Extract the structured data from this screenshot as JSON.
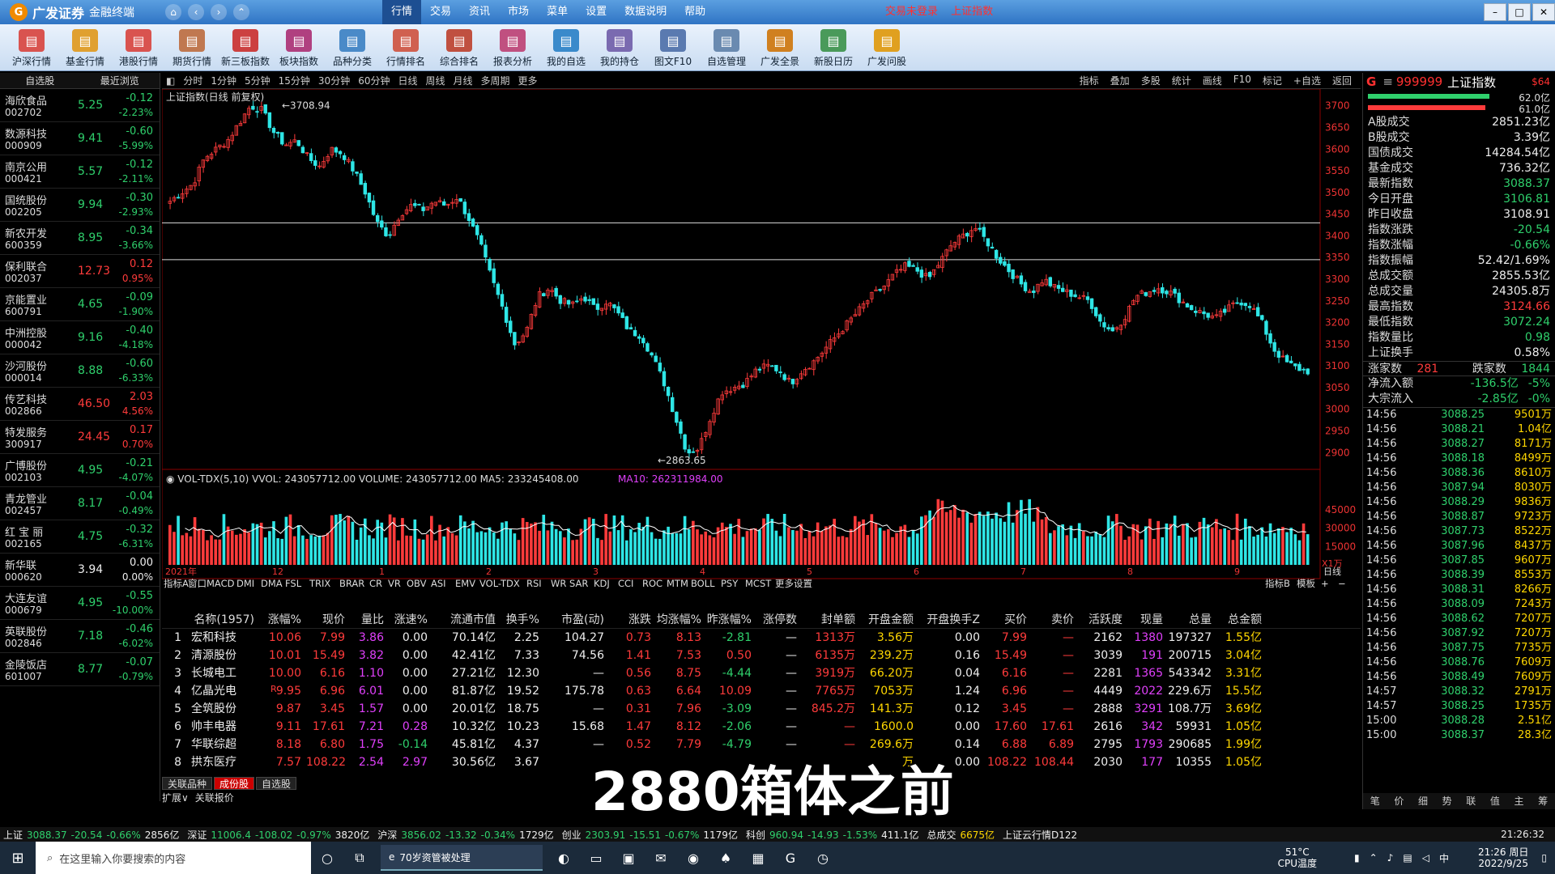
{
  "app": {
    "name": "广发证券",
    "subtitle": "金融终端",
    "login_status": "交易未登录",
    "index_link": "上证指数"
  },
  "top_menu": [
    "行情",
    "交易",
    "资讯",
    "市场",
    "菜单",
    "设置",
    "数据说明",
    "帮助"
  ],
  "toolbar": [
    {
      "label": "沪深行情",
      "icon": "market-icon",
      "color": "#d9534f"
    },
    {
      "label": "基金行情",
      "icon": "fund-icon",
      "color": "#e0a030"
    },
    {
      "label": "港股行情",
      "icon": "hk-icon",
      "color": "#d9534f"
    },
    {
      "label": "期货行情",
      "icon": "futures-icon",
      "color": "#c07850"
    },
    {
      "label": "新三板指数",
      "icon": "neeq-icon",
      "color": "#cc4040"
    },
    {
      "label": "板块指数",
      "icon": "sector-icon",
      "color": "#b04080"
    },
    {
      "label": "品种分类",
      "icon": "category-icon",
      "color": "#4a8ac8"
    },
    {
      "label": "行情排名",
      "icon": "rank-icon",
      "color": "#d06050"
    },
    {
      "label": "综合排名",
      "icon": "composite-icon",
      "color": "#c05040"
    },
    {
      "label": "报表分析",
      "icon": "report-icon",
      "color": "#c05080"
    },
    {
      "label": "我的自选",
      "icon": "favorite-icon",
      "color": "#3a8acb"
    },
    {
      "label": "我的持仓",
      "icon": "holding-icon",
      "color": "#7a6ab0"
    },
    {
      "label": "图文F10",
      "icon": "f10-icon",
      "color": "#5a7ab0"
    },
    {
      "label": "自选管理",
      "icon": "manage-icon",
      "color": "#6a8ab0"
    },
    {
      "label": "广发全景",
      "icon": "panorama-icon",
      "color": "#d08020"
    },
    {
      "label": "新股日历",
      "icon": "calendar-icon",
      "color": "#4a9a5a"
    },
    {
      "label": "广发问股",
      "icon": "ask-icon",
      "color": "#e0a020"
    }
  ],
  "watchlist": {
    "tabs": [
      "自选股",
      "最近浏览"
    ],
    "items": [
      {
        "name": "海欣食品",
        "code": "002702",
        "price": "5.25",
        "change": "-0.12",
        "pct": "-2.23%",
        "dir": "down"
      },
      {
        "name": "数源科技",
        "code": "000909",
        "price": "9.41",
        "change": "-0.60",
        "pct": "-5.99%",
        "dir": "down"
      },
      {
        "name": "南京公用",
        "code": "000421",
        "price": "5.57",
        "change": "-0.12",
        "pct": "-2.11%",
        "dir": "down"
      },
      {
        "name": "国统股份",
        "code": "002205",
        "price": "9.94",
        "change": "-0.30",
        "pct": "-2.93%",
        "dir": "down"
      },
      {
        "name": "新农开发",
        "code": "600359",
        "price": "8.95",
        "change": "-0.34",
        "pct": "-3.66%",
        "dir": "down"
      },
      {
        "name": "保利联合",
        "code": "002037",
        "price": "12.73",
        "change": "0.12",
        "pct": "0.95%",
        "dir": "up"
      },
      {
        "name": "京能置业",
        "code": "600791",
        "price": "4.65",
        "change": "-0.09",
        "pct": "-1.90%",
        "dir": "down"
      },
      {
        "name": "中洲控股",
        "code": "000042",
        "price": "9.16",
        "change": "-0.40",
        "pct": "-4.18%",
        "dir": "down"
      },
      {
        "name": "沙河股份",
        "code": "000014",
        "price": "8.88",
        "change": "-0.60",
        "pct": "-6.33%",
        "dir": "down"
      },
      {
        "name": "传艺科技",
        "code": "002866",
        "price": "46.50",
        "change": "2.03",
        "pct": "4.56%",
        "dir": "up"
      },
      {
        "name": "特发服务",
        "code": "300917",
        "price": "24.45",
        "change": "0.17",
        "pct": "0.70%",
        "dir": "up"
      },
      {
        "name": "广博股份",
        "code": "002103",
        "price": "4.95",
        "change": "-0.21",
        "pct": "-4.07%",
        "dir": "down"
      },
      {
        "name": "青龙管业",
        "code": "002457",
        "price": "8.17",
        "change": "-0.04",
        "pct": "-0.49%",
        "dir": "down"
      },
      {
        "name": "红 宝 丽",
        "code": "002165",
        "price": "4.75",
        "change": "-0.32",
        "pct": "-6.31%",
        "dir": "down"
      },
      {
        "name": "新华联",
        "code": "000620",
        "price": "3.94",
        "change": "0.00",
        "pct": "0.00%",
        "dir": "flat"
      },
      {
        "name": "大连友谊",
        "code": "000679",
        "price": "4.95",
        "change": "-0.55",
        "pct": "-10.00%",
        "dir": "down"
      },
      {
        "name": "英联股份",
        "code": "002846",
        "price": "7.18",
        "change": "-0.46",
        "pct": "-6.02%",
        "dir": "down"
      },
      {
        "name": "金陵饭店",
        "code": "601007",
        "price": "8.77",
        "change": "-0.07",
        "pct": "-0.79%",
        "dir": "down"
      }
    ]
  },
  "period_bar": {
    "items": [
      "分时",
      "1分钟",
      "5分钟",
      "15分钟",
      "30分钟",
      "60分钟",
      "日线",
      "周线",
      "月线",
      "多周期",
      "更多"
    ],
    "right": [
      "指标",
      "叠加",
      "多股",
      "统计",
      "画线",
      "F10",
      "标记",
      "+自选",
      "返回"
    ]
  },
  "chart_title": "上证指数(日线 前复权)",
  "chart_data": {
    "type": "candlestick",
    "title": "上证指数(日线 前复权)",
    "ylim": [
      2880,
      3720
    ],
    "y_ticks": [
      "3700",
      "3650",
      "3600",
      "3550",
      "3500",
      "3450",
      "3400",
      "3350",
      "3300",
      "3250",
      "3200",
      "3150",
      "3100",
      "3050",
      "3000",
      "2950",
      "2900"
    ],
    "x_labels": [
      "2021年",
      "12",
      "1",
      "2",
      "3",
      "4",
      "5",
      "6",
      "7",
      "8",
      "9"
    ],
    "annotations": {
      "high": "3708.94",
      "low": "2863.65"
    },
    "hlines": [
      3430,
      3345
    ],
    "close_path": [
      3480,
      3500,
      3520,
      3580,
      3600,
      3620,
      3660,
      3700,
      3690,
      3640,
      3610,
      3620,
      3580,
      3560,
      3600,
      3590,
      3550,
      3500,
      3430,
      3400,
      3450,
      3470,
      3460,
      3480,
      3470,
      3490,
      3440,
      3380,
      3300,
      3230,
      3150,
      3180,
      3260,
      3280,
      3250,
      3240,
      3260,
      3230,
      3250,
      3220,
      3180,
      3170,
      3120,
      3060,
      2980,
      2900,
      2910,
      2980,
      3040,
      3050,
      3060,
      3090,
      3100,
      3090,
      3060,
      3090,
      3110,
      3140,
      3170,
      3200,
      3230,
      3260,
      3280,
      3310,
      3330,
      3320,
      3300,
      3340,
      3380,
      3400,
      3420,
      3390,
      3350,
      3320,
      3290,
      3270,
      3300,
      3280,
      3270,
      3260,
      3250,
      3200,
      3180,
      3210,
      3260,
      3270,
      3280,
      3270,
      3250,
      3230,
      3220,
      3210,
      3230,
      3250,
      3240,
      3200,
      3140,
      3110,
      3095,
      3088
    ],
    "volume_indicator": {
      "name": "VOL-TDX(5,10)",
      "VVOL": "243057712.00",
      "VOLUME": "243057712.00",
      "MA5": "233245408.00",
      "MA10": "262311984.00",
      "y_ticks": [
        "45000",
        "30000",
        "15000"
      ],
      "unit": "X1万"
    },
    "period_label": "日线"
  },
  "indicator_tabs": [
    "指标A",
    "窗口",
    "MACD",
    "DMI",
    "DMA",
    "FSL",
    "TRIX",
    "BRAR",
    "CR",
    "VR",
    "OBV",
    "ASI",
    "EMV",
    "VOL-TDX",
    "RSI",
    "WR",
    "SAR",
    "KDJ",
    "CCI",
    "ROC",
    "MTM",
    "BOLL",
    "PSY",
    "MCST",
    "更多",
    "设置"
  ],
  "indicator_tabs_right": [
    "指标B",
    "模板",
    "+",
    "−"
  ],
  "table": {
    "headers": [
      "",
      "名称(1957)",
      "涨幅%",
      "现价",
      "量比",
      "涨速%",
      "流通市值",
      "换手%",
      "市盈(动)",
      "涨跌",
      "均涨幅%",
      "昨涨幅%",
      "涨停数",
      "封单额",
      "开盘金额",
      "开盘换手Z",
      "买价",
      "卖价",
      "活跃度",
      "现量",
      "总量",
      "总金额"
    ],
    "rows": [
      [
        "1",
        "宏和科技",
        "10.06",
        "7.99",
        "3.86",
        "0.00",
        "70.14亿",
        "2.25",
        "104.27",
        "0.73",
        "8.13",
        "-2.81",
        "—",
        "1313万",
        "3.56万",
        "0.00",
        "7.99",
        "—",
        "2162",
        "1380",
        "197327",
        "1.55亿"
      ],
      [
        "2",
        "清源股份",
        "10.01",
        "15.49",
        "3.82",
        "0.00",
        "42.41亿",
        "7.33",
        "74.56",
        "1.41",
        "7.53",
        "0.50",
        "—",
        "6135万",
        "239.2万",
        "0.16",
        "15.49",
        "—",
        "3039",
        "191",
        "200715",
        "3.04亿"
      ],
      [
        "3",
        "长城电工",
        "10.00",
        "6.16",
        "1.10",
        "0.00",
        "27.21亿",
        "12.30",
        "—",
        "0.56",
        "8.75",
        "-4.44",
        "—",
        "3919万",
        "66.20万",
        "0.04",
        "6.16",
        "—",
        "2281",
        "1365",
        "543342",
        "3.31亿"
      ],
      [
        "4",
        "亿晶光电",
        "9.95",
        "6.96",
        "6.01",
        "0.00",
        "81.87亿",
        "19.52",
        "175.78",
        "0.63",
        "6.64",
        "10.09",
        "—",
        "7765万",
        "7053万",
        "1.24",
        "6.96",
        "—",
        "4449",
        "2022",
        "229.6万",
        "15.5亿"
      ],
      [
        "5",
        "全筑股份",
        "9.87",
        "3.45",
        "1.57",
        "0.00",
        "20.01亿",
        "18.75",
        "—",
        "0.31",
        "7.96",
        "-3.09",
        "—",
        "845.2万",
        "141.3万",
        "0.12",
        "3.45",
        "—",
        "2888",
        "3291",
        "108.7万",
        "3.69亿"
      ],
      [
        "6",
        "帅丰电器",
        "9.11",
        "17.61",
        "7.21",
        "0.28",
        "10.32亿",
        "10.23",
        "15.68",
        "1.47",
        "8.12",
        "-2.06",
        "—",
        "—",
        "1600.0",
        "0.00",
        "17.60",
        "17.61",
        "2616",
        "342",
        "59931",
        "1.05亿"
      ],
      [
        "7",
        "华联综超",
        "8.18",
        "6.80",
        "1.75",
        "-0.14",
        "45.81亿",
        "4.37",
        "—",
        "0.52",
        "7.79",
        "-4.79",
        "—",
        "—",
        "269.6万",
        "0.14",
        "6.88",
        "6.89",
        "2795",
        "1793",
        "290685",
        "1.99亿"
      ],
      [
        "8",
        "拱东医疗",
        "7.57",
        "108.22",
        "2.54",
        "2.97",
        "30.56亿",
        "3.67",
        "",
        "",
        "",
        "",
        "",
        "",
        "万",
        "0.00",
        "108.22",
        "108.44",
        "2030",
        "177",
        "10355",
        "1.05亿"
      ]
    ],
    "marker": "R"
  },
  "bottom_tabs": [
    "关联品种",
    "成份股",
    "自选股"
  ],
  "bottom_tabs2": [
    "扩展∨",
    "关联报价"
  ],
  "right_panel": {
    "code": "999999",
    "name": "上证指数",
    "tag": "G",
    "num": "$64",
    "bar1": "62.0亿",
    "bar2": "61.0亿",
    "stats": [
      {
        "k": "A股成交",
        "v": "2851.23亿",
        "c": "white"
      },
      {
        "k": "B股成交",
        "v": "3.39亿",
        "c": "white"
      },
      {
        "k": "国债成交",
        "v": "14284.54亿",
        "c": "white"
      },
      {
        "k": "基金成交",
        "v": "736.32亿",
        "c": "white"
      },
      {
        "k": "最新指数",
        "v": "3088.37",
        "c": "green"
      },
      {
        "k": "今日开盘",
        "v": "3106.81",
        "c": "green"
      },
      {
        "k": "昨日收盘",
        "v": "3108.91",
        "c": "white"
      },
      {
        "k": "指数涨跌",
        "v": "-20.54",
        "c": "green"
      },
      {
        "k": "指数涨幅",
        "v": "-0.66%",
        "c": "green"
      },
      {
        "k": "指数振幅",
        "v": "52.42/1.69%",
        "c": "white"
      },
      {
        "k": "总成交额",
        "v": "2855.53亿",
        "c": "white"
      },
      {
        "k": "总成交量",
        "v": "24305.8万",
        "c": "white"
      },
      {
        "k": "最高指数",
        "v": "3124.66",
        "c": "red"
      },
      {
        "k": "最低指数",
        "v": "3072.24",
        "c": "green"
      },
      {
        "k": "指数量比",
        "v": "0.98",
        "c": "green"
      },
      {
        "k": "上证换手",
        "v": "0.58%",
        "c": "white"
      }
    ],
    "updown": {
      "up_label": "涨家数",
      "up": "281",
      "down_label": "跌家数",
      "down": "1844"
    },
    "flows": [
      {
        "k": "净流入额",
        "v": "-136.5亿",
        "p": "-5%"
      },
      {
        "k": "大宗流入",
        "v": "-2.85亿",
        "p": "-0%"
      }
    ],
    "ticks": [
      {
        "t": "14:56",
        "p": "3088.25",
        "v": "9501万"
      },
      {
        "t": "14:56",
        "p": "3088.21",
        "v": "1.04亿"
      },
      {
        "t": "14:56",
        "p": "3088.27",
        "v": "8171万"
      },
      {
        "t": "14:56",
        "p": "3088.18",
        "v": "8499万"
      },
      {
        "t": "14:56",
        "p": "3088.36",
        "v": "8610万"
      },
      {
        "t": "14:56",
        "p": "3087.94",
        "v": "8030万"
      },
      {
        "t": "14:56",
        "p": "3088.29",
        "v": "9836万"
      },
      {
        "t": "14:56",
        "p": "3088.87",
        "v": "9723万"
      },
      {
        "t": "14:56",
        "p": "3087.73",
        "v": "8522万"
      },
      {
        "t": "14:56",
        "p": "3087.96",
        "v": "8437万"
      },
      {
        "t": "14:56",
        "p": "3087.85",
        "v": "9607万"
      },
      {
        "t": "14:56",
        "p": "3088.39",
        "v": "8553万"
      },
      {
        "t": "14:56",
        "p": "3088.31",
        "v": "8266万"
      },
      {
        "t": "14:56",
        "p": "3088.09",
        "v": "7243万"
      },
      {
        "t": "14:56",
        "p": "3088.62",
        "v": "7207万"
      },
      {
        "t": "14:56",
        "p": "3087.92",
        "v": "7207万"
      },
      {
        "t": "14:56",
        "p": "3087.75",
        "v": "7735万"
      },
      {
        "t": "14:56",
        "p": "3088.76",
        "v": "7609万"
      },
      {
        "t": "14:56",
        "p": "3088.49",
        "v": "7609万"
      },
      {
        "t": "14:57",
        "p": "3088.32",
        "v": "2791万"
      },
      {
        "t": "14:57",
        "p": "3088.25",
        "v": "1735万"
      },
      {
        "t": "15:00",
        "p": "3088.28",
        "v": "2.51亿"
      },
      {
        "t": "15:00",
        "p": "3088.37",
        "v": "28.3亿"
      }
    ],
    "bottom": [
      "笔",
      "价",
      "细",
      "势",
      "联",
      "值",
      "主",
      "筹"
    ]
  },
  "status_bar": [
    {
      "label": "上证",
      "v": "3088.37",
      "c": "-20.54",
      "p": "-0.66%",
      "a": "2856亿"
    },
    {
      "label": "深证",
      "v": "11006.4",
      "c": "-108.02",
      "p": "-0.97%",
      "a": "3820亿"
    },
    {
      "label": "沪深",
      "v": "3856.02",
      "c": "-13.32",
      "p": "-0.34%",
      "a": "1729亿"
    },
    {
      "label": "创业",
      "v": "2303.91",
      "c": "-15.51",
      "p": "-0.67%",
      "a": "1179亿"
    },
    {
      "label": "科创",
      "v": "960.94",
      "c": "-14.93",
      "p": "-1.53%",
      "a": "411.1亿"
    },
    {
      "label": "总成交",
      "v": "6675亿",
      "c": "",
      "p": "",
      "a": ""
    },
    {
      "label": "上证云行情D122",
      "v": "",
      "c": "",
      "p": "",
      "a": ""
    }
  ],
  "status_time": "21:26:32",
  "caption": "2880箱体之前",
  "taskbar": {
    "search_placeholder": "在这里输入你要搜索的内容",
    "edge_tab": "70岁资管被处理",
    "temp": "51°C",
    "cpu": "CPU温度",
    "time": "21:26 周日",
    "date": "2022/9/25",
    "ime": "中"
  }
}
